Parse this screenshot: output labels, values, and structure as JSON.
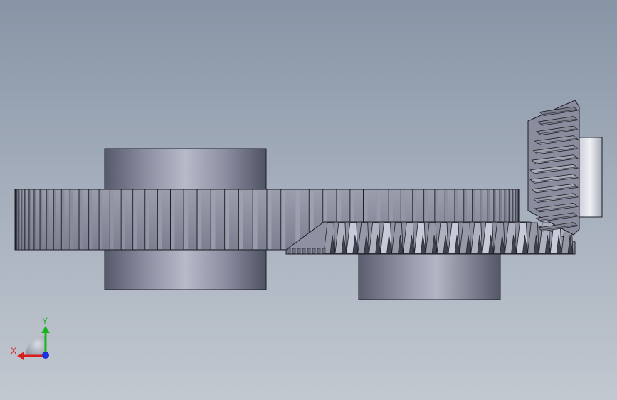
{
  "viewport": {
    "description_free": true,
    "background_top": "#8795a6",
    "background_bottom": "#c2c8d0"
  },
  "model": {
    "part_color_light": "#b9bcc8",
    "part_color_mid": "#8c8fa0",
    "part_color_dark": "#4a4d5c",
    "edge_color": "#1e1f26"
  },
  "triad": {
    "x_label": "X",
    "y_label": "Y",
    "x_color": "#d81e1e",
    "y_color": "#18b41e",
    "z_color": "#1e32dc",
    "x_icon": "arrow-x-icon",
    "y_icon": "arrow-y-icon",
    "z_icon": "origin-z-icon"
  }
}
